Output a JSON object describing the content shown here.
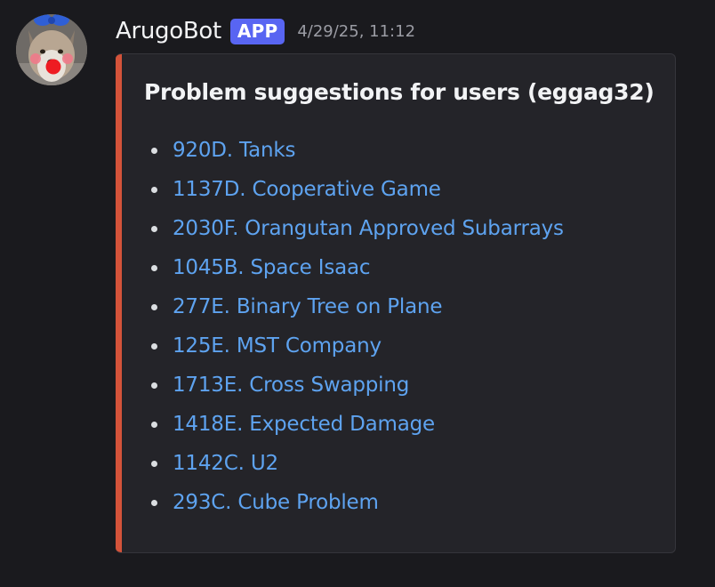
{
  "message": {
    "username": "ArugoBot",
    "badge": "APP",
    "timestamp": "4/29/25, 11:12",
    "avatar_icon": "wolf-avatar-icon"
  },
  "embed": {
    "accent_color": "#d4533a",
    "title": "Problem suggestions for users (eggag32)",
    "problems": [
      {
        "label": "920D. Tanks"
      },
      {
        "label": "1137D. Cooperative Game"
      },
      {
        "label": "2030F. Orangutan Approved Subarrays"
      },
      {
        "label": "1045B. Space Isaac"
      },
      {
        "label": "277E. Binary Tree on Plane"
      },
      {
        "label": "125E. MST Company"
      },
      {
        "label": "1713E. Cross Swapping"
      },
      {
        "label": "1418E. Expected Damage"
      },
      {
        "label": "1142C. U2"
      },
      {
        "label": "293C. Cube Problem"
      }
    ]
  },
  "colors": {
    "background": "#1a1a1e",
    "embed_background": "#242429",
    "link": "#5ea3f0",
    "badge": "#5865f2"
  }
}
